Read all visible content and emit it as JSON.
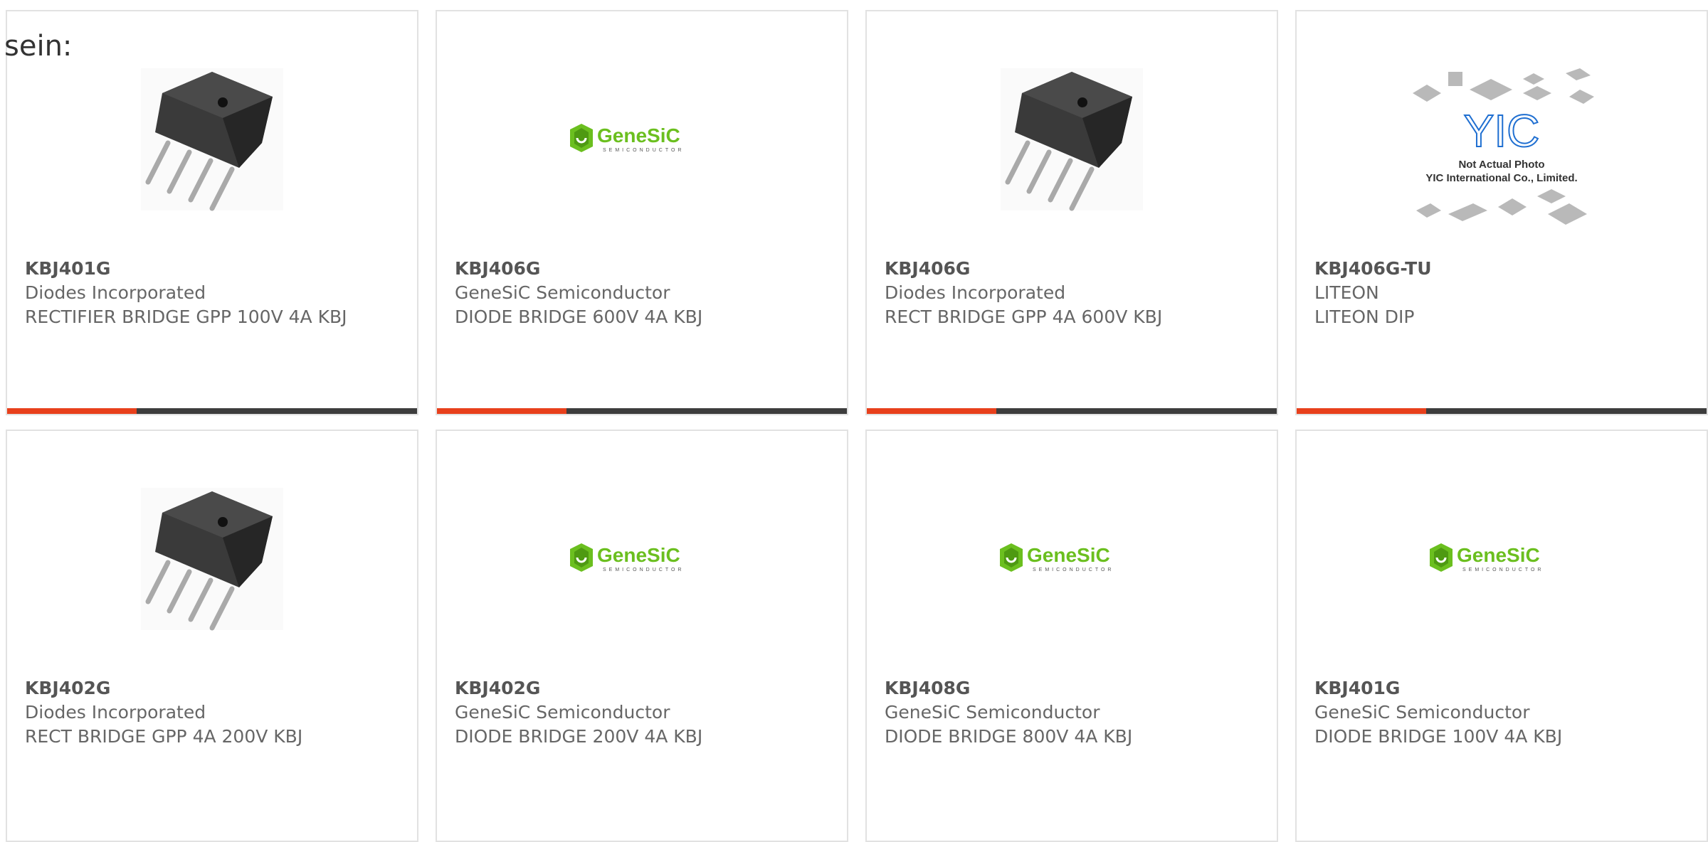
{
  "stray_text": "sein:",
  "colors": {
    "accent": "#e8401c",
    "bar": "#3d3d3d",
    "genesic_green": "#6bbf1f",
    "yic_blue": "#1f6fd1"
  },
  "products": [
    {
      "part": "KBJ401G",
      "manufacturer": "Diodes Incorporated",
      "description": "RECTIFIER BRIDGE GPP 100V 4A KBJ",
      "image": "kbj-package-photo"
    },
    {
      "part": "KBJ406G",
      "manufacturer": "GeneSiC Semiconductor",
      "description": "DIODE BRIDGE 600V 4A KBJ",
      "image": "genesic-logo"
    },
    {
      "part": "KBJ406G",
      "manufacturer": "Diodes Incorporated",
      "description": "RECT BRIDGE GPP 4A 600V KBJ",
      "image": "kbj-package-photo"
    },
    {
      "part": "KBJ406G-TU",
      "manufacturer": "LITEON",
      "description": "LITEON DIP",
      "image": "yic-placeholder"
    },
    {
      "part": "KBJ402G",
      "manufacturer": "Diodes Incorporated",
      "description": "RECT BRIDGE GPP 4A 200V KBJ",
      "image": "kbj-package-photo"
    },
    {
      "part": "KBJ402G",
      "manufacturer": "GeneSiC Semiconductor",
      "description": "DIODE BRIDGE 200V 4A KBJ",
      "image": "genesic-logo"
    },
    {
      "part": "KBJ408G",
      "manufacturer": "GeneSiC Semiconductor",
      "description": "DIODE BRIDGE 800V 4A KBJ",
      "image": "genesic-logo"
    },
    {
      "part": "KBJ401G",
      "manufacturer": "GeneSiC Semiconductor",
      "description": "DIODE BRIDGE 100V 4A KBJ",
      "image": "genesic-logo"
    }
  ],
  "genesic_logo": {
    "word": "GeneSiC",
    "sub": "SEMICONDUCTOR"
  },
  "yic_placeholder": {
    "mark": "YIC",
    "line1": "Not Actual Photo",
    "line2": "YIC International Co., Limited."
  }
}
